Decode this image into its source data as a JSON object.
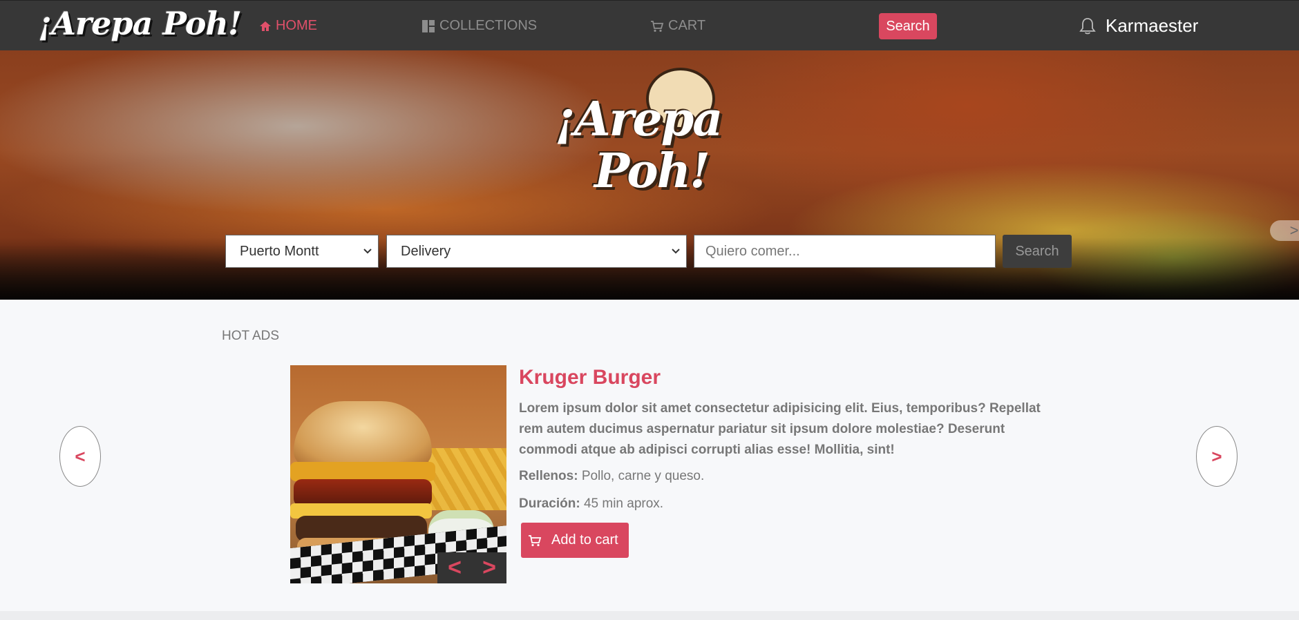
{
  "nav": {
    "brand": "¡Arepa Poh!",
    "home": "HOME",
    "collections": "COLLECTIONS",
    "cart": "CART",
    "search_button": "Search",
    "username": "Karmaester"
  },
  "hero": {
    "logo_line1": "¡Arepa",
    "logo_line2": "Poh!",
    "city_select": "Puerto Montt",
    "mode_select": "Delivery",
    "search_placeholder": "Quiero comer...",
    "search_button": "Search",
    "slide_next": ">"
  },
  "hot_ads": {
    "section_title": "HOT ADS",
    "prev": "<",
    "next": ">",
    "image_prev": "<",
    "image_next": ">",
    "item": {
      "title": "Kruger Burger",
      "description": "Lorem ipsum dolor sit amet consectetur adipisicing elit. Eius, temporibus? Repellat rem autem ducimus aspernatur pariatur sit ipsum dolore molestiae? Deserunt commodi atque ab adipisci corrupti alias esse! Mollitia, sint!",
      "rellenos_label": "Rellenos:",
      "rellenos_value": "Pollo, carne y queso.",
      "duracion_label": "Duración:",
      "duracion_value": "45 min aprox.",
      "add_to_cart": "Add to cart"
    }
  },
  "colors": {
    "accent": "#d9475f",
    "navbar": "#373737",
    "page_bg": "#f7f8fa"
  }
}
